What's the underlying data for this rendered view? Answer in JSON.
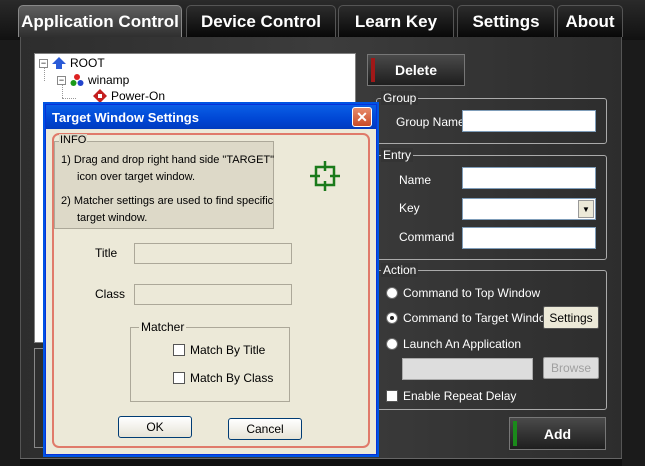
{
  "tabs": [
    {
      "label": "Application Control",
      "active": true
    },
    {
      "label": "Device Control",
      "active": false
    },
    {
      "label": "Learn Key",
      "active": false
    },
    {
      "label": "Settings",
      "active": false
    },
    {
      "label": "About",
      "active": false
    }
  ],
  "tree": {
    "root": {
      "label": "ROOT",
      "toggle": "−",
      "icon": "up-arrow-icon"
    },
    "child": {
      "label": "winamp",
      "toggle": "−",
      "icon": "app-icon"
    },
    "leaf": {
      "label": "Power-On",
      "icon": "key-icon"
    }
  },
  "buttons": {
    "delete": "Delete",
    "add": "Add"
  },
  "group": {
    "legend": "Group",
    "name_label": "Group Name",
    "name_value": ""
  },
  "entry": {
    "legend": "Entry",
    "name_label": "Name",
    "name_value": "",
    "key_label": "Key",
    "key_value": "",
    "command_label": "Command",
    "command_value": ""
  },
  "action": {
    "legend": "Action",
    "options": [
      {
        "label": "Command to Top Window",
        "selected": false
      },
      {
        "label": "Command to Target Window",
        "selected": true
      },
      {
        "label": "Launch An Application",
        "selected": false
      }
    ],
    "settings_button": "Settings",
    "browse_button": "Browse",
    "app_path": "",
    "repeat_delay_label": "Enable Repeat Delay",
    "repeat_delay_checked": false
  },
  "dialog": {
    "title": "Target Window Settings",
    "close_label": "✕",
    "info": {
      "legend": "INFO",
      "line1": "1) Drag and drop right hand side \"TARGET\"",
      "line2": "icon over target window.",
      "line3": "2) Matcher settings are used to find specific",
      "line4": "target window."
    },
    "title_label": "Title",
    "title_value": "",
    "class_label": "Class",
    "class_value": "",
    "matcher": {
      "legend": "Matcher",
      "by_title_label": "Match By Title",
      "by_title_checked": false,
      "by_class_label": "Match By Class",
      "by_class_checked": false
    },
    "ok_button": "OK",
    "cancel_button": "Cancel"
  },
  "colors": {
    "dialog_title_blue": "#0046d4",
    "frame_highlight": "#e07a6a",
    "target_green": "#1a7a1a",
    "delete_stripe": "#a01818",
    "add_stripe": "#1a8a1a"
  }
}
